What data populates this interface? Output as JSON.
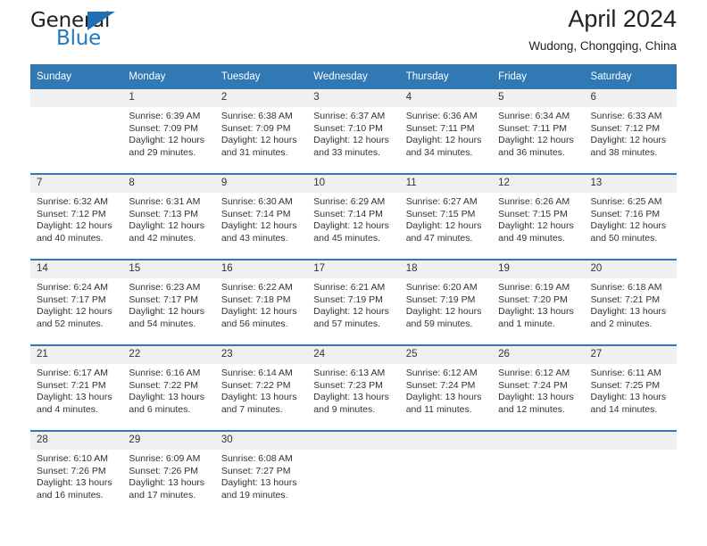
{
  "brand": {
    "name_top": "General",
    "name_bottom": "Blue",
    "triangle_icon": "brand-triangle-icon",
    "color_dark": "#231f20",
    "color_blue": "#1f7ac0"
  },
  "header": {
    "title": "April 2024",
    "subtitle": "Wudong, Chongqing, China"
  },
  "theme": {
    "header_bg": "#3079b5",
    "daynum_bg": "#f0f0f0",
    "text": "#333333"
  },
  "calendar": {
    "weekdays": [
      "Sunday",
      "Monday",
      "Tuesday",
      "Wednesday",
      "Thursday",
      "Friday",
      "Saturday"
    ],
    "weeks": [
      [
        {
          "day": "",
          "sunrise": "",
          "sunset": "",
          "daylight1": "",
          "daylight2": ""
        },
        {
          "day": "1",
          "sunrise": "Sunrise: 6:39 AM",
          "sunset": "Sunset: 7:09 PM",
          "daylight1": "Daylight: 12 hours",
          "daylight2": "and 29 minutes."
        },
        {
          "day": "2",
          "sunrise": "Sunrise: 6:38 AM",
          "sunset": "Sunset: 7:09 PM",
          "daylight1": "Daylight: 12 hours",
          "daylight2": "and 31 minutes."
        },
        {
          "day": "3",
          "sunrise": "Sunrise: 6:37 AM",
          "sunset": "Sunset: 7:10 PM",
          "daylight1": "Daylight: 12 hours",
          "daylight2": "and 33 minutes."
        },
        {
          "day": "4",
          "sunrise": "Sunrise: 6:36 AM",
          "sunset": "Sunset: 7:11 PM",
          "daylight1": "Daylight: 12 hours",
          "daylight2": "and 34 minutes."
        },
        {
          "day": "5",
          "sunrise": "Sunrise: 6:34 AM",
          "sunset": "Sunset: 7:11 PM",
          "daylight1": "Daylight: 12 hours",
          "daylight2": "and 36 minutes."
        },
        {
          "day": "6",
          "sunrise": "Sunrise: 6:33 AM",
          "sunset": "Sunset: 7:12 PM",
          "daylight1": "Daylight: 12 hours",
          "daylight2": "and 38 minutes."
        }
      ],
      [
        {
          "day": "7",
          "sunrise": "Sunrise: 6:32 AM",
          "sunset": "Sunset: 7:12 PM",
          "daylight1": "Daylight: 12 hours",
          "daylight2": "and 40 minutes."
        },
        {
          "day": "8",
          "sunrise": "Sunrise: 6:31 AM",
          "sunset": "Sunset: 7:13 PM",
          "daylight1": "Daylight: 12 hours",
          "daylight2": "and 42 minutes."
        },
        {
          "day": "9",
          "sunrise": "Sunrise: 6:30 AM",
          "sunset": "Sunset: 7:14 PM",
          "daylight1": "Daylight: 12 hours",
          "daylight2": "and 43 minutes."
        },
        {
          "day": "10",
          "sunrise": "Sunrise: 6:29 AM",
          "sunset": "Sunset: 7:14 PM",
          "daylight1": "Daylight: 12 hours",
          "daylight2": "and 45 minutes."
        },
        {
          "day": "11",
          "sunrise": "Sunrise: 6:27 AM",
          "sunset": "Sunset: 7:15 PM",
          "daylight1": "Daylight: 12 hours",
          "daylight2": "and 47 minutes."
        },
        {
          "day": "12",
          "sunrise": "Sunrise: 6:26 AM",
          "sunset": "Sunset: 7:15 PM",
          "daylight1": "Daylight: 12 hours",
          "daylight2": "and 49 minutes."
        },
        {
          "day": "13",
          "sunrise": "Sunrise: 6:25 AM",
          "sunset": "Sunset: 7:16 PM",
          "daylight1": "Daylight: 12 hours",
          "daylight2": "and 50 minutes."
        }
      ],
      [
        {
          "day": "14",
          "sunrise": "Sunrise: 6:24 AM",
          "sunset": "Sunset: 7:17 PM",
          "daylight1": "Daylight: 12 hours",
          "daylight2": "and 52 minutes."
        },
        {
          "day": "15",
          "sunrise": "Sunrise: 6:23 AM",
          "sunset": "Sunset: 7:17 PM",
          "daylight1": "Daylight: 12 hours",
          "daylight2": "and 54 minutes."
        },
        {
          "day": "16",
          "sunrise": "Sunrise: 6:22 AM",
          "sunset": "Sunset: 7:18 PM",
          "daylight1": "Daylight: 12 hours",
          "daylight2": "and 56 minutes."
        },
        {
          "day": "17",
          "sunrise": "Sunrise: 6:21 AM",
          "sunset": "Sunset: 7:19 PM",
          "daylight1": "Daylight: 12 hours",
          "daylight2": "and 57 minutes."
        },
        {
          "day": "18",
          "sunrise": "Sunrise: 6:20 AM",
          "sunset": "Sunset: 7:19 PM",
          "daylight1": "Daylight: 12 hours",
          "daylight2": "and 59 minutes."
        },
        {
          "day": "19",
          "sunrise": "Sunrise: 6:19 AM",
          "sunset": "Sunset: 7:20 PM",
          "daylight1": "Daylight: 13 hours",
          "daylight2": "and 1 minute."
        },
        {
          "day": "20",
          "sunrise": "Sunrise: 6:18 AM",
          "sunset": "Sunset: 7:21 PM",
          "daylight1": "Daylight: 13 hours",
          "daylight2": "and 2 minutes."
        }
      ],
      [
        {
          "day": "21",
          "sunrise": "Sunrise: 6:17 AM",
          "sunset": "Sunset: 7:21 PM",
          "daylight1": "Daylight: 13 hours",
          "daylight2": "and 4 minutes."
        },
        {
          "day": "22",
          "sunrise": "Sunrise: 6:16 AM",
          "sunset": "Sunset: 7:22 PM",
          "daylight1": "Daylight: 13 hours",
          "daylight2": "and 6 minutes."
        },
        {
          "day": "23",
          "sunrise": "Sunrise: 6:14 AM",
          "sunset": "Sunset: 7:22 PM",
          "daylight1": "Daylight: 13 hours",
          "daylight2": "and 7 minutes."
        },
        {
          "day": "24",
          "sunrise": "Sunrise: 6:13 AM",
          "sunset": "Sunset: 7:23 PM",
          "daylight1": "Daylight: 13 hours",
          "daylight2": "and 9 minutes."
        },
        {
          "day": "25",
          "sunrise": "Sunrise: 6:12 AM",
          "sunset": "Sunset: 7:24 PM",
          "daylight1": "Daylight: 13 hours",
          "daylight2": "and 11 minutes."
        },
        {
          "day": "26",
          "sunrise": "Sunrise: 6:12 AM",
          "sunset": "Sunset: 7:24 PM",
          "daylight1": "Daylight: 13 hours",
          "daylight2": "and 12 minutes."
        },
        {
          "day": "27",
          "sunrise": "Sunrise: 6:11 AM",
          "sunset": "Sunset: 7:25 PM",
          "daylight1": "Daylight: 13 hours",
          "daylight2": "and 14 minutes."
        }
      ],
      [
        {
          "day": "28",
          "sunrise": "Sunrise: 6:10 AM",
          "sunset": "Sunset: 7:26 PM",
          "daylight1": "Daylight: 13 hours",
          "daylight2": "and 16 minutes."
        },
        {
          "day": "29",
          "sunrise": "Sunrise: 6:09 AM",
          "sunset": "Sunset: 7:26 PM",
          "daylight1": "Daylight: 13 hours",
          "daylight2": "and 17 minutes."
        },
        {
          "day": "30",
          "sunrise": "Sunrise: 6:08 AM",
          "sunset": "Sunset: 7:27 PM",
          "daylight1": "Daylight: 13 hours",
          "daylight2": "and 19 minutes."
        },
        {
          "day": "",
          "sunrise": "",
          "sunset": "",
          "daylight1": "",
          "daylight2": ""
        },
        {
          "day": "",
          "sunrise": "",
          "sunset": "",
          "daylight1": "",
          "daylight2": ""
        },
        {
          "day": "",
          "sunrise": "",
          "sunset": "",
          "daylight1": "",
          "daylight2": ""
        },
        {
          "day": "",
          "sunrise": "",
          "sunset": "",
          "daylight1": "",
          "daylight2": ""
        }
      ]
    ]
  }
}
